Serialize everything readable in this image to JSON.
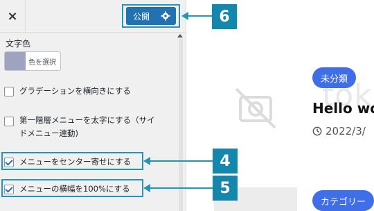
{
  "topbar": {
    "close_label": "×",
    "publish_label": "公開"
  },
  "panel": {
    "section_label": "文字色",
    "color_button_label": "色を選択",
    "color_value": "#9fa3bf",
    "options": [
      {
        "label": "グラデーションを横向きにする",
        "checked": false
      },
      {
        "label": "第一階層メニューを太字にする（サイ",
        "label2": "ドメニュー連動)",
        "checked": false
      },
      {
        "label": "メニューをセンター寄せにする",
        "checked": true
      },
      {
        "label": "メニューの横幅を100%にする",
        "checked": true
      }
    ]
  },
  "annotations": {
    "badge_publish": "6",
    "badge_center": "4",
    "badge_width": "5",
    "accent_color": "#2395b8"
  },
  "preview": {
    "category_pill_1": "未分類",
    "post_title": "Hello wo",
    "post_date": "2022/3/",
    "category_pill_2": "カテゴリー",
    "pill_color": "#3f6ee8",
    "watermark": "tokidata"
  }
}
